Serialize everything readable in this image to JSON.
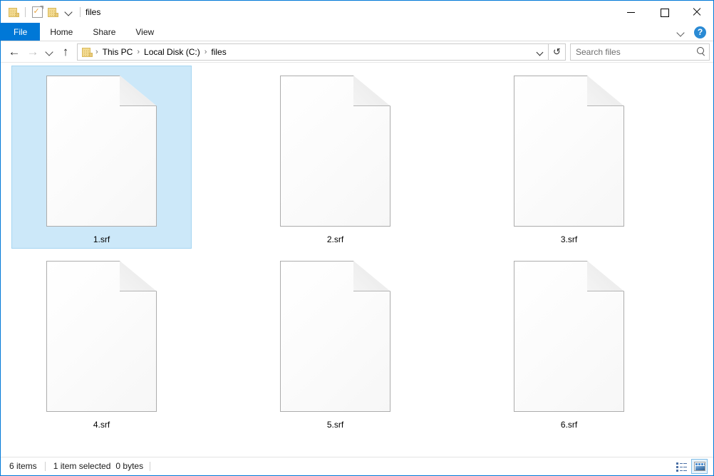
{
  "window": {
    "title": "files",
    "quick_access": [
      {
        "name": "folder-icon",
        "label": "Folder"
      },
      {
        "name": "properties-icon",
        "label": "Properties"
      },
      {
        "name": "new-folder-icon",
        "label": "New folder"
      },
      {
        "name": "chevron-down-icon",
        "label": "Customize Quick Access Toolbar"
      }
    ],
    "controls": {
      "minimize": "—",
      "maximize": "□",
      "close": "✕"
    }
  },
  "ribbon": {
    "tabs": [
      {
        "label": "File",
        "active": true
      },
      {
        "label": "Home",
        "active": false
      },
      {
        "label": "Share",
        "active": false
      },
      {
        "label": "View",
        "active": false
      }
    ],
    "expand_label": "Expand the Ribbon",
    "help_label": "?"
  },
  "navigation": {
    "back_label": "←",
    "forward_label": "→",
    "recent_label": "Recent locations",
    "up_label": "↑",
    "breadcrumb": [
      {
        "label": "This PC"
      },
      {
        "label": "Local Disk (C:)"
      },
      {
        "label": "files"
      }
    ],
    "separator": "›",
    "refresh_label": "↻"
  },
  "search": {
    "placeholder": "Search files",
    "value": ""
  },
  "files": [
    {
      "name": "1.srf",
      "selected": true
    },
    {
      "name": "2.srf",
      "selected": false
    },
    {
      "name": "3.srf",
      "selected": false
    },
    {
      "name": "4.srf",
      "selected": false
    },
    {
      "name": "5.srf",
      "selected": false
    },
    {
      "name": "6.srf",
      "selected": false
    }
  ],
  "status": {
    "item_count": "6 items",
    "selection": "1 item selected",
    "size": "0 bytes"
  },
  "view_toggles": {
    "details": "Details view",
    "large_icons": "Large icons view",
    "active": "large_icons"
  },
  "colors": {
    "accent": "#0078d7",
    "selection_fill": "#cce8f9",
    "selection_border": "#a5d5f2",
    "help_blue": "#2a8ad4",
    "folder_yellow": "#f2d98f"
  }
}
